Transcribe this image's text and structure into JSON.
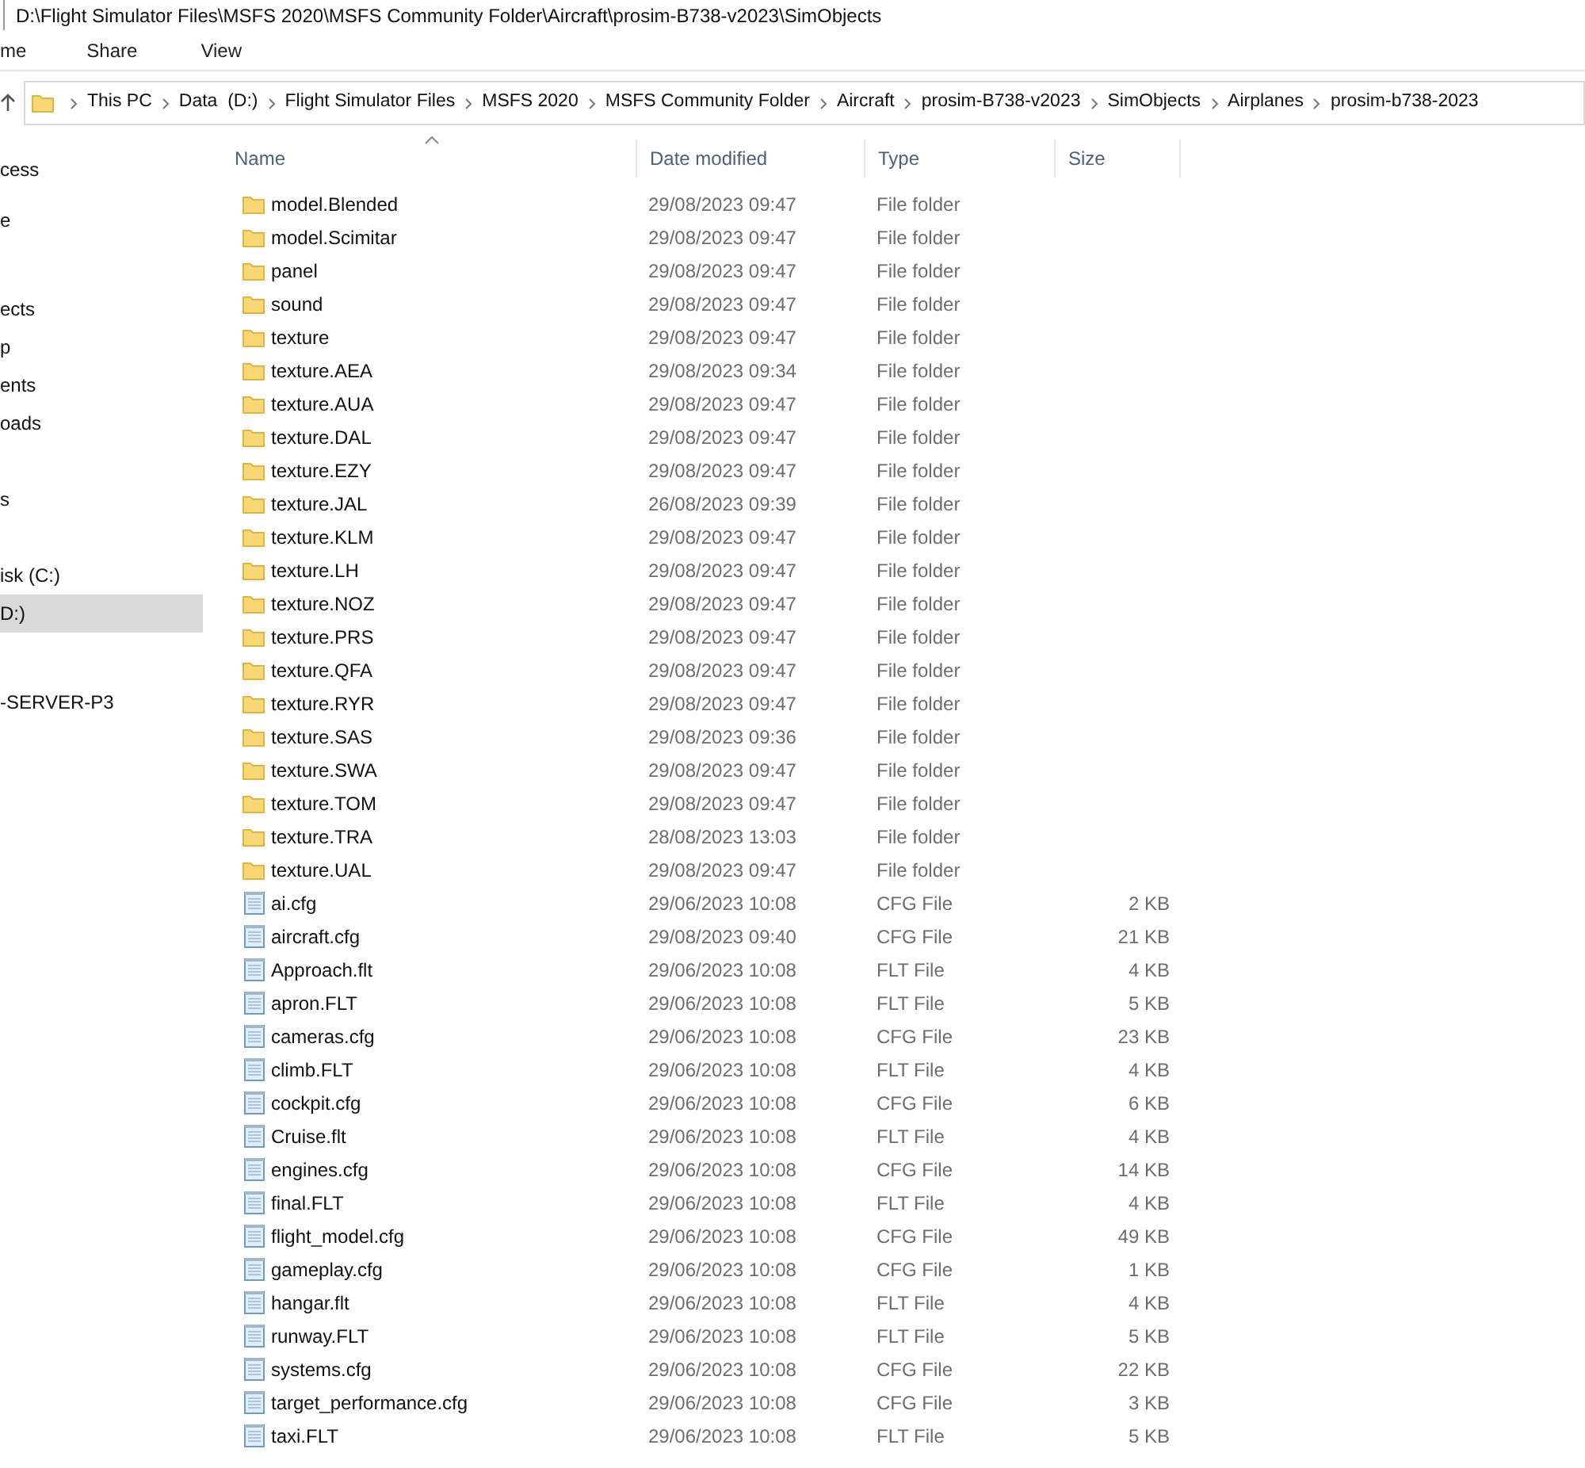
{
  "window": {
    "title": "D:\\Flight Simulator Files\\MSFS 2020\\MSFS Community Folder\\Aircraft\\prosim-B738-v2023\\SimObjects"
  },
  "ribbon_tabs": [
    "me",
    "Share",
    "View"
  ],
  "address_bar": {
    "breadcrumbs": [
      "This PC",
      "Data  (D:)",
      "Flight Simulator Files",
      "MSFS 2020",
      "MSFS Community Folder",
      "Aircraft",
      "prosim-B738-v2023",
      "SimObjects",
      "Airplanes",
      "prosim-b738-2023"
    ]
  },
  "sidebar": {
    "items": [
      {
        "label": "cess",
        "selected": false
      },
      {
        "label": "e",
        "selected": false
      },
      {
        "label": "ects",
        "selected": false
      },
      {
        "label": "p",
        "selected": false
      },
      {
        "label": "ents",
        "selected": false
      },
      {
        "label": "oads",
        "selected": false
      },
      {
        "label": "s",
        "selected": false
      },
      {
        "label": "isk (C:)",
        "selected": false
      },
      {
        "label": "D:)",
        "selected": true
      },
      {
        "label": "-SERVER-P3",
        "selected": false
      }
    ]
  },
  "table": {
    "columns": [
      "Name",
      "Date modified",
      "Type",
      "Size"
    ],
    "rows": [
      {
        "kind": "folder",
        "name": "model.Blended",
        "date": "29/08/2023 09:47",
        "type": "File folder"
      },
      {
        "kind": "folder",
        "name": "model.Scimitar",
        "date": "29/08/2023 09:47",
        "type": "File folder"
      },
      {
        "kind": "folder",
        "name": "panel",
        "date": "29/08/2023 09:47",
        "type": "File folder"
      },
      {
        "kind": "folder",
        "name": "sound",
        "date": "29/08/2023 09:47",
        "type": "File folder"
      },
      {
        "kind": "folder",
        "name": "texture",
        "date": "29/08/2023 09:47",
        "type": "File folder"
      },
      {
        "kind": "folder",
        "name": "texture.AEA",
        "date": "29/08/2023 09:34",
        "type": "File folder"
      },
      {
        "kind": "folder",
        "name": "texture.AUA",
        "date": "29/08/2023 09:47",
        "type": "File folder"
      },
      {
        "kind": "folder",
        "name": "texture.DAL",
        "date": "29/08/2023 09:47",
        "type": "File folder"
      },
      {
        "kind": "folder",
        "name": "texture.EZY",
        "date": "29/08/2023 09:47",
        "type": "File folder"
      },
      {
        "kind": "folder",
        "name": "texture.JAL",
        "date": "26/08/2023 09:39",
        "type": "File folder"
      },
      {
        "kind": "folder",
        "name": "texture.KLM",
        "date": "29/08/2023 09:47",
        "type": "File folder"
      },
      {
        "kind": "folder",
        "name": "texture.LH",
        "date": "29/08/2023 09:47",
        "type": "File folder"
      },
      {
        "kind": "folder",
        "name": "texture.NOZ",
        "date": "29/08/2023 09:47",
        "type": "File folder"
      },
      {
        "kind": "folder",
        "name": "texture.PRS",
        "date": "29/08/2023 09:47",
        "type": "File folder"
      },
      {
        "kind": "folder",
        "name": "texture.QFA",
        "date": "29/08/2023 09:47",
        "type": "File folder"
      },
      {
        "kind": "folder",
        "name": "texture.RYR",
        "date": "29/08/2023 09:47",
        "type": "File folder"
      },
      {
        "kind": "folder",
        "name": "texture.SAS",
        "date": "29/08/2023 09:36",
        "type": "File folder"
      },
      {
        "kind": "folder",
        "name": "texture.SWA",
        "date": "29/08/2023 09:47",
        "type": "File folder"
      },
      {
        "kind": "folder",
        "name": "texture.TOM",
        "date": "29/08/2023 09:47",
        "type": "File folder"
      },
      {
        "kind": "folder",
        "name": "texture.TRA",
        "date": "28/08/2023 13:03",
        "type": "File folder"
      },
      {
        "kind": "folder",
        "name": "texture.UAL",
        "date": "29/08/2023 09:47",
        "type": "File folder"
      },
      {
        "kind": "file",
        "name": "ai.cfg",
        "date": "29/06/2023 10:08",
        "type": "CFG File",
        "size": "2 KB"
      },
      {
        "kind": "file",
        "name": "aircraft.cfg",
        "date": "29/08/2023 09:40",
        "type": "CFG File",
        "size": "21 KB"
      },
      {
        "kind": "file",
        "name": "Approach.flt",
        "date": "29/06/2023 10:08",
        "type": "FLT File",
        "size": "4 KB"
      },
      {
        "kind": "file",
        "name": "apron.FLT",
        "date": "29/06/2023 10:08",
        "type": "FLT File",
        "size": "5 KB"
      },
      {
        "kind": "file",
        "name": "cameras.cfg",
        "date": "29/06/2023 10:08",
        "type": "CFG File",
        "size": "23 KB"
      },
      {
        "kind": "file",
        "name": "climb.FLT",
        "date": "29/06/2023 10:08",
        "type": "FLT File",
        "size": "4 KB"
      },
      {
        "kind": "file",
        "name": "cockpit.cfg",
        "date": "29/06/2023 10:08",
        "type": "CFG File",
        "size": "6 KB"
      },
      {
        "kind": "file",
        "name": "Cruise.flt",
        "date": "29/06/2023 10:08",
        "type": "FLT File",
        "size": "4 KB"
      },
      {
        "kind": "file",
        "name": "engines.cfg",
        "date": "29/06/2023 10:08",
        "type": "CFG File",
        "size": "14 KB"
      },
      {
        "kind": "file",
        "name": "final.FLT",
        "date": "29/06/2023 10:08",
        "type": "FLT File",
        "size": "4 KB"
      },
      {
        "kind": "file",
        "name": "flight_model.cfg",
        "date": "29/06/2023 10:08",
        "type": "CFG File",
        "size": "49 KB"
      },
      {
        "kind": "file",
        "name": "gameplay.cfg",
        "date": "29/06/2023 10:08",
        "type": "CFG File",
        "size": "1 KB"
      },
      {
        "kind": "file",
        "name": "hangar.flt",
        "date": "29/06/2023 10:08",
        "type": "FLT File",
        "size": "4 KB"
      },
      {
        "kind": "file",
        "name": "runway.FLT",
        "date": "29/06/2023 10:08",
        "type": "FLT File",
        "size": "5 KB"
      },
      {
        "kind": "file",
        "name": "systems.cfg",
        "date": "29/06/2023 10:08",
        "type": "CFG File",
        "size": "22 KB"
      },
      {
        "kind": "file",
        "name": "target_performance.cfg",
        "date": "29/06/2023 10:08",
        "type": "CFG File",
        "size": "3 KB"
      },
      {
        "kind": "file",
        "name": "taxi.FLT",
        "date": "29/06/2023 10:08",
        "type": "FLT File",
        "size": "5 KB"
      }
    ]
  }
}
